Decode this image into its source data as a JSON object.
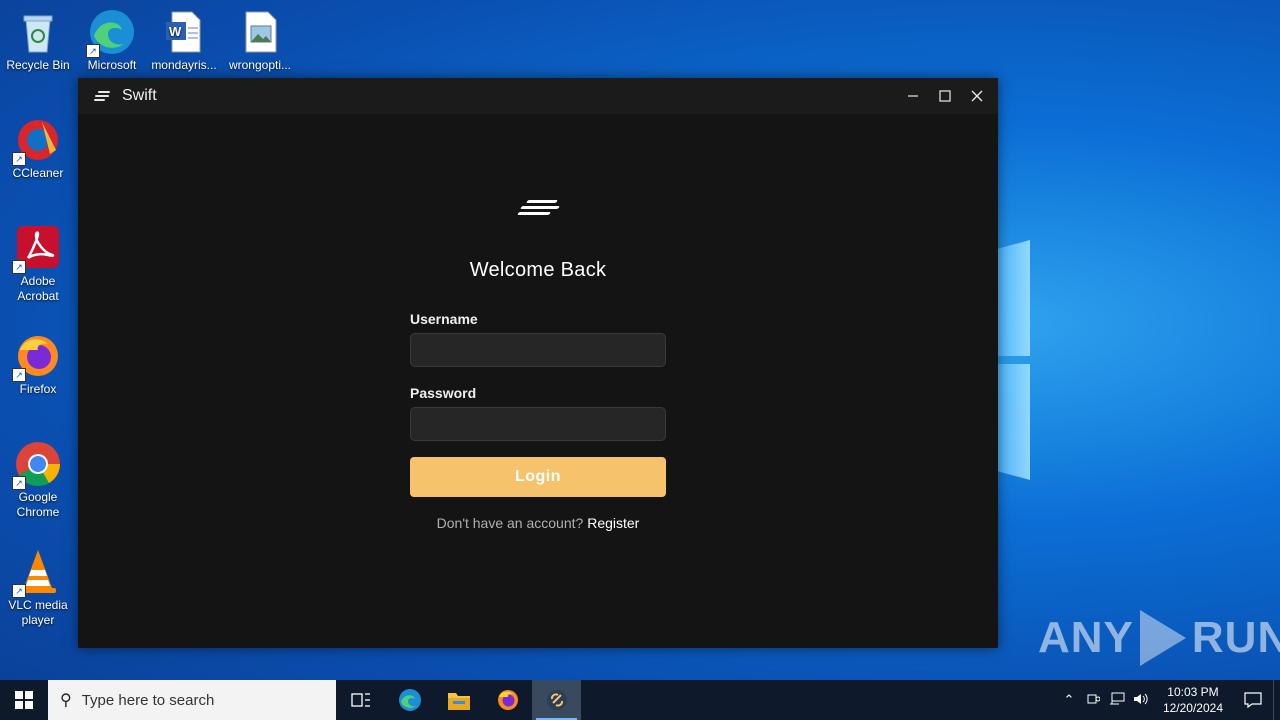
{
  "desktop": {
    "icons": [
      {
        "label": "Recycle Bin"
      },
      {
        "label": "Microsoft Edge"
      },
      {
        "label": "mondayris..."
      },
      {
        "label": "wrongopti..."
      },
      {
        "label": "CCleaner"
      },
      {
        "label": "Adobe Acrobat"
      },
      {
        "label": "Firefox"
      },
      {
        "label": "Google Chrome"
      },
      {
        "label": "VLC media player"
      }
    ]
  },
  "window": {
    "title": "Swift",
    "heading": "Welcome Back",
    "username_label": "Username",
    "username_value": "",
    "password_label": "Password",
    "password_value": "",
    "login_label": "Login",
    "register_prompt": "Don't have an account?",
    "register_link": "Register",
    "accent_color": "#f6c26b"
  },
  "watermark": {
    "left": "ANY",
    "right": "RUN"
  },
  "taskbar": {
    "search_placeholder": "Type here to search",
    "time": "10:03 PM",
    "date": "12/20/2024"
  }
}
